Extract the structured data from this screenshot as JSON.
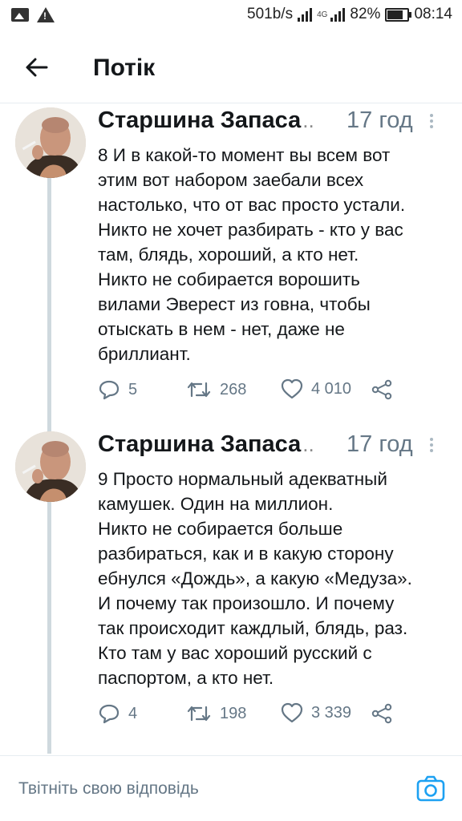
{
  "status_bar": {
    "speed": "501b/s",
    "network": "4G",
    "battery": "82%",
    "time": "08:14"
  },
  "header": {
    "title": "Потік"
  },
  "tweets": [
    {
      "author": "Старшина Запаса",
      "ellipsis": "..",
      "time": "17 год",
      "lines": [
        "8 И в какой-то момент вы всем вот",
        "этим вот набором заебали всех",
        "настолько, что от вас просто устали.",
        "Никто не хочет разбирать - кто у вас",
        "там, блядь, хороший, а кто нет.",
        "Никто не собирается ворошить",
        "вилами Эверест из говна, чтобы",
        "отыскать в нем - нет, даже не",
        "бриллиант."
      ],
      "replies": "5",
      "retweets": "268",
      "likes": "4 010"
    },
    {
      "author": "Старшина Запаса",
      "ellipsis": "..",
      "time": "17 год",
      "lines": [
        "9 Просто нормальный адекватный",
        "камушек. Один на миллион.",
        "Никто не собирается больше",
        "разбираться, как и в какую сторону",
        "ебнулся «Дождь», а какую «Медуза».",
        "И почему так произошло. И почему",
        "так происходит каждлый, блядь, раз.",
        "Кто там у вас хороший русский с",
        "паспортом, а кто нет."
      ],
      "replies": "4",
      "retweets": "198",
      "likes": "3 339"
    }
  ],
  "reply_bar": {
    "placeholder": "Твітніть свою відповідь"
  },
  "colors": {
    "accent": "#1da1f2",
    "muted": "#657786",
    "thread_line": "#cfd9de"
  }
}
